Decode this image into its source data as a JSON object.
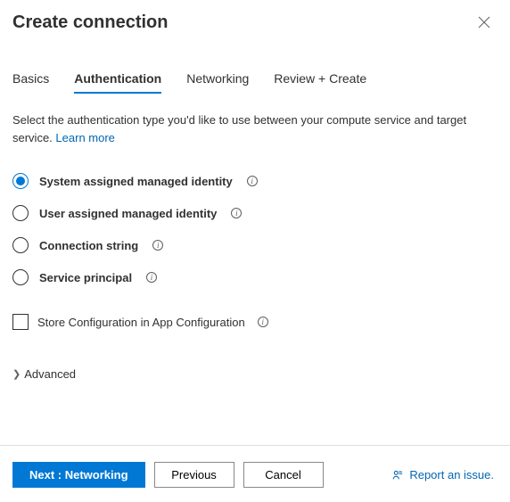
{
  "header": {
    "title": "Create connection"
  },
  "tabs": [
    {
      "label": "Basics",
      "active": false
    },
    {
      "label": "Authentication",
      "active": true
    },
    {
      "label": "Networking",
      "active": false
    },
    {
      "label": "Review + Create",
      "active": false
    }
  ],
  "description": "Select the authentication type you'd like to use between your compute service and target service.",
  "learnMore": "Learn more",
  "authOptions": [
    {
      "label": "System assigned managed identity",
      "selected": true
    },
    {
      "label": "User assigned managed identity",
      "selected": false
    },
    {
      "label": "Connection string",
      "selected": false
    },
    {
      "label": "Service principal",
      "selected": false
    }
  ],
  "storeConfig": {
    "label": "Store Configuration in App Configuration",
    "checked": false
  },
  "advanced": {
    "label": "Advanced"
  },
  "footer": {
    "next": "Next : Networking",
    "previous": "Previous",
    "cancel": "Cancel",
    "report": "Report an issue."
  }
}
